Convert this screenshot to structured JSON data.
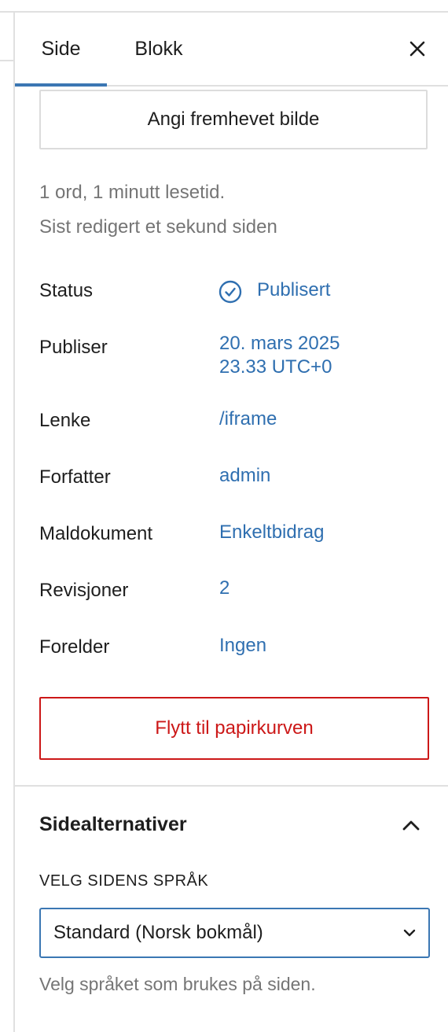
{
  "tabs": {
    "side": "Side",
    "blokk": "Blokk",
    "close_icon": "close-icon"
  },
  "featured_image": {
    "label": "Angi fremhevet bilde"
  },
  "meta": {
    "word_count": "1 ord, 1 minutt lesetid.",
    "last_edited": "Sist redigert et sekund siden"
  },
  "rows": {
    "status": {
      "label": "Status",
      "value": "Publisert",
      "icon": "check-circle-icon"
    },
    "publish": {
      "label": "Publiser",
      "value_line1": "20. mars 2025",
      "value_line2": "23.33 UTC+0"
    },
    "link": {
      "label": "Lenke",
      "value": "/iframe"
    },
    "author": {
      "label": "Forfatter",
      "value": "admin"
    },
    "template": {
      "label": "Maldokument",
      "value": "Enkeltbidrag"
    },
    "revisions": {
      "label": "Revisjoner",
      "value": "2"
    },
    "parent": {
      "label": "Forelder",
      "value": "Ingen"
    }
  },
  "trash": {
    "label": "Flytt til papirkurven"
  },
  "page_options": {
    "title": "Sidealternativer",
    "language_label": "VELG SIDENS SPRÅK",
    "language_selected": "Standard (Norsk bokmål)",
    "language_help": "Velg språket som brukes på siden."
  },
  "colors": {
    "accent": "#3b77b3",
    "link": "#2f6fb0",
    "danger": "#cc1818",
    "muted": "#757575",
    "border": "#e0e0e0"
  }
}
